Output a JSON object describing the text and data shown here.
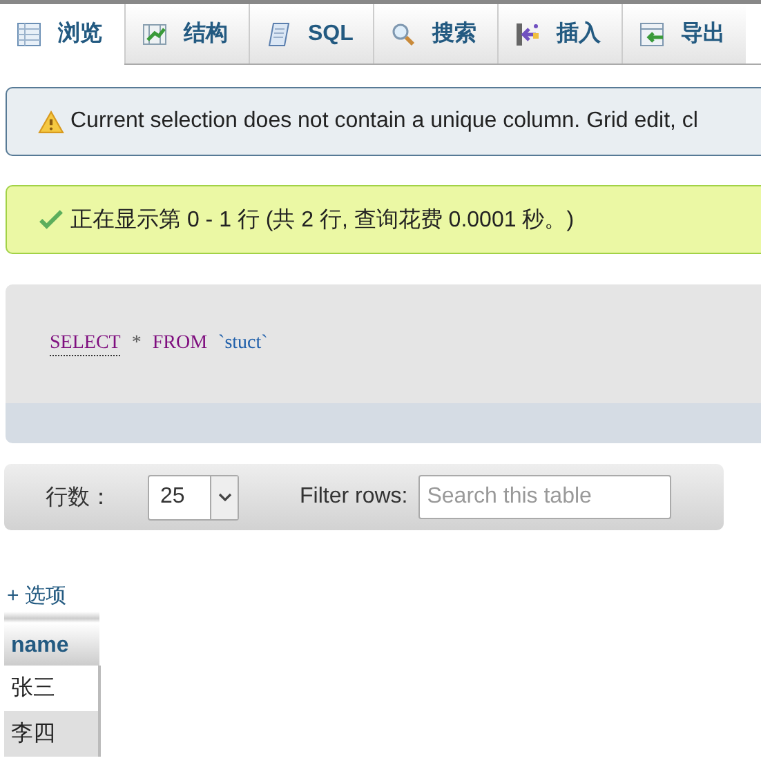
{
  "tabs": [
    {
      "label": "浏览",
      "kind": "table",
      "selected": true
    },
    {
      "label": "结构",
      "kind": "structure",
      "selected": false
    },
    {
      "label": "SQL",
      "kind": "scroll",
      "selected": false
    },
    {
      "label": "搜索",
      "kind": "search",
      "selected": false
    },
    {
      "label": "插入",
      "kind": "insert",
      "selected": false
    },
    {
      "label": "导出",
      "kind": "export",
      "selected": false
    }
  ],
  "notices": [
    {
      "kind": "warning",
      "text": "Current selection does not contain a unique column. Grid edit, cl"
    },
    {
      "kind": "success",
      "text": "正在显示第 0 - 1 行 (共 2 行, 查询花费 0.0001 秒。)"
    }
  ],
  "sql": [
    {
      "kind": "keyword",
      "text": "SELECT",
      "link": true
    },
    {
      "kind": "operator",
      "text": "*"
    },
    {
      "kind": "keyword",
      "text": "FROM"
    },
    {
      "kind": "identifier",
      "text": "`stuct`"
    }
  ],
  "toolbar": {
    "rows_label": "行数：",
    "rows_value": "25",
    "filter_label": "Filter rows:",
    "filter_placeholder": "Search this table"
  },
  "options_link": "+ 选项",
  "table": {
    "columns": [
      "name"
    ],
    "rows": [
      [
        "张三"
      ],
      [
        "李四"
      ]
    ]
  }
}
